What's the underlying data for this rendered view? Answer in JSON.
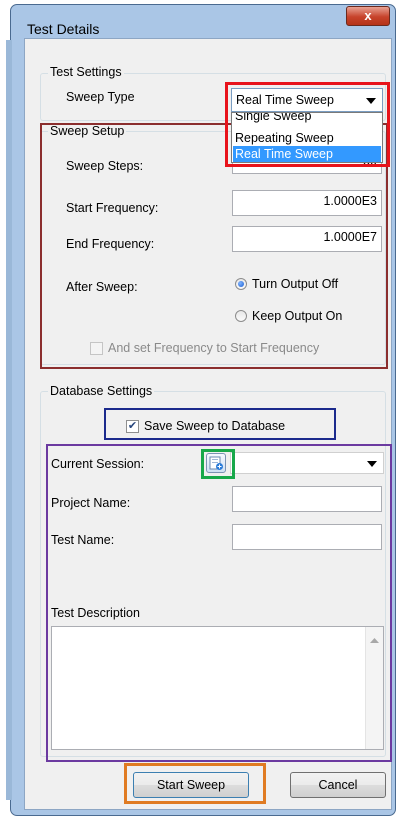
{
  "window": {
    "title": "Test Details",
    "close_glyph": "x"
  },
  "test_settings": {
    "legend": "Test Settings",
    "sweep_type_label": "Sweep Type",
    "sweep_type_value": "Real Time Sweep",
    "sweep_type_options": [
      "Single Sweep",
      "Repeating Sweep",
      "Real Time Sweep"
    ]
  },
  "sweep_setup": {
    "legend": "Sweep Setup",
    "steps_label": "Sweep Steps:",
    "steps_value_partial": "50",
    "start_label": "Start Frequency:",
    "start_value": "1.0000E3",
    "end_label": "End Frequency:",
    "end_value": "1.0000E7",
    "after_label": "After Sweep:",
    "radio_off": "Turn Output Off",
    "radio_on": "Keep Output On",
    "set_freq_label": "And set Frequency to Start Frequency"
  },
  "database": {
    "legend": "Database Settings",
    "save_label": "Save Sweep to Database",
    "session_label": "Current Session:",
    "project_label": "Project Name:",
    "test_label": "Test Name:",
    "description_label": "Test Description"
  },
  "buttons": {
    "start": "Start Sweep",
    "cancel": "Cancel"
  },
  "colors": {
    "highlight_red": "#e8131b",
    "highlight_maroon": "#8b2e2e",
    "highlight_blue": "#1b2a8c",
    "highlight_green": "#18a84a",
    "highlight_purple": "#6b3aa0",
    "highlight_orange": "#e07b22",
    "selection": "#3399ff"
  }
}
